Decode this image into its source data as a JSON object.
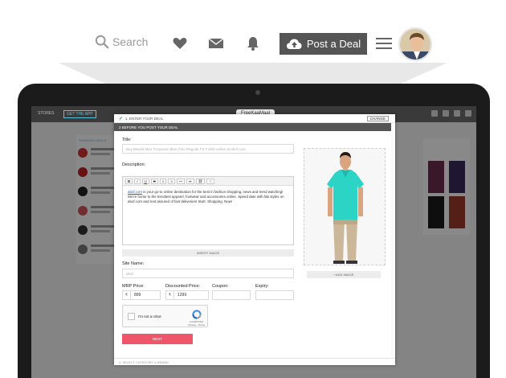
{
  "nav": {
    "search_placeholder": "Search",
    "post_deal_label": "Post a Deal",
    "icons": [
      "search-icon",
      "heart-icon",
      "mail-icon",
      "bell-icon",
      "cloud-upload-icon",
      "hamburger-icon"
    ]
  },
  "background_page": {
    "stores": "STORES",
    "get_app": "GET THE APP",
    "logo": "FreeKaaMaal",
    "trending": "TRENDING DEALS",
    "deals": [
      "Get Airtel Prepaid + Recharge",
      "Get Rs 7 Off Bus Ticket",
      "Get 47% Off + Free Sh",
      "All PASSE Off + Pas",
      "FLAT 75% OFF",
      "Buy One Get 50% Off"
    ]
  },
  "modal": {
    "step1_label": "1. ENTER YOUR DEAL",
    "change_label": "CHANGE",
    "step2_label": "2 BEFORE YOU POST YOUR DEAL",
    "title_label": "Title:",
    "title_value": "Buy Bewinl Men Turquoise Blue Polo Regular Fit T-shirt online at abof.com",
    "description_label": "Description:",
    "toolbar": [
      "B",
      "I",
      "U",
      "S",
      "≡",
      "≡",
      "↤",
      "↦",
      "⛓",
      "⤫"
    ],
    "description_link": "abof.com",
    "description_text": " is your go-to online destination for the best in fashion shopping, news and trend watching! We're home to the trendiest apparel, footwear and accessories online. Speed date with fab styles on abof.com and rest assured of fast deliveries! Start. Shopping. Now!",
    "insert_image": "INSERT IMAGE",
    "site_name_label": "Site Name:",
    "site_name_value": "abof",
    "mrp_label": "MRP Price:",
    "mrp_currency": "₹",
    "mrp_value": "899",
    "discounted_label": "Discounted Price:",
    "discounted_currency": "₹",
    "discounted_value": "1299",
    "coupon_label": "Coupon:",
    "expiry_label": "Expiry:",
    "captcha_text": "I'm not a robot",
    "captcha_brand": "reCAPTCHA",
    "captcha_sub": "Privacy - Terms",
    "next_label": "NEXT",
    "add_image": "+ADD IMAGE",
    "step3_label": "3. SELECT CATEGORY & BRAND"
  },
  "colors": {
    "accent_pink": "#f0566a",
    "dark_bar": "#555555",
    "link_blue": "#1a64c8",
    "check_green": "#2aa85a",
    "shirt_teal": "#2bd4c4"
  }
}
